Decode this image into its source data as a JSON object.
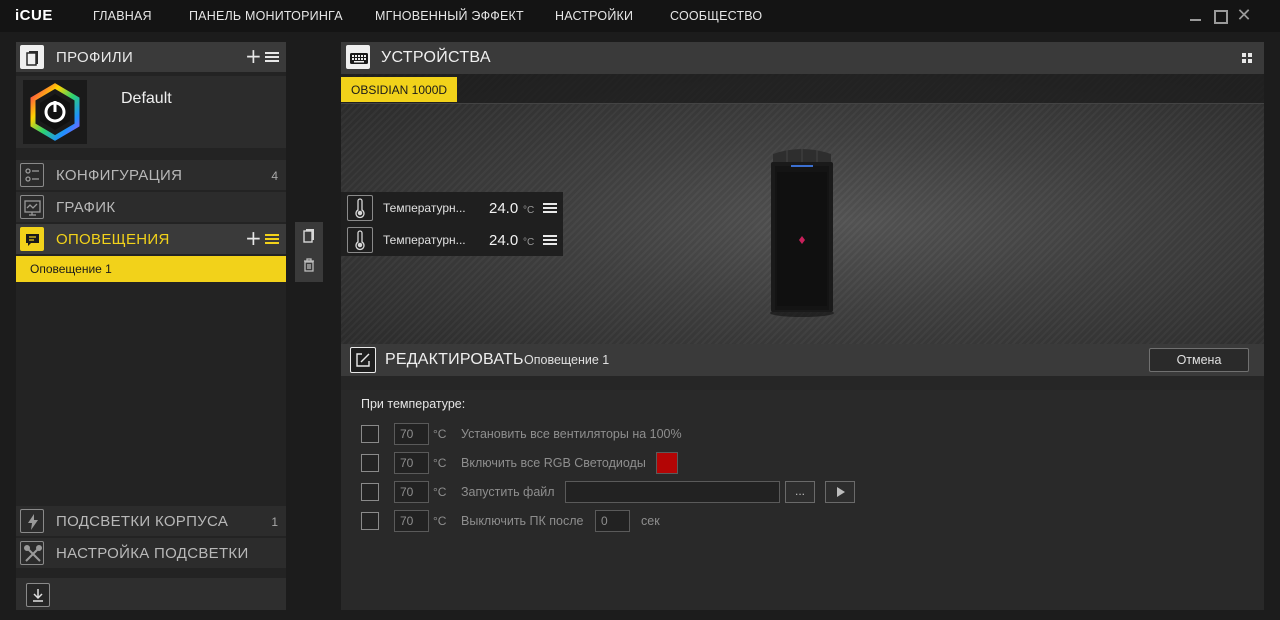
{
  "app": {
    "logo": "iCUE"
  },
  "nav": [
    "ГЛАВНАЯ",
    "ПАНЕЛЬ МОНИТОРИНГА",
    "МГНОВЕННЫЙ ЭФФЕКТ",
    "НАСТРОЙКИ",
    "СООБЩЕСТВО"
  ],
  "window_controls": {
    "close_glyph": "✕"
  },
  "profiles": {
    "title": "ПРОФИЛИ",
    "plus": "+",
    "items": [
      {
        "name": "Default"
      }
    ]
  },
  "sections": {
    "config": {
      "title": "КОНФИГУРАЦИЯ",
      "count": "4"
    },
    "graph": {
      "title": "ГРАФИК"
    },
    "notifications": {
      "title": "ОПОВЕЩЕНИЯ",
      "plus": "+",
      "items": [
        {
          "label": "Оповещение 1"
        }
      ]
    },
    "case_lighting": {
      "title": "ПОДСВЕТКИ КОРПУСА",
      "count": "1"
    },
    "lighting_setup": {
      "title": "НАСТРОЙКА ПОДСВЕТКИ"
    }
  },
  "devices": {
    "title": "УСТРОЙСТВА",
    "tabs": [
      {
        "label": "OBSIDIAN 1000D",
        "active": true
      }
    ],
    "sensors": [
      {
        "label": "Температурн...",
        "value": "24.0",
        "unit": "°C"
      },
      {
        "label": "Температурн...",
        "value": "24.0",
        "unit": "°C"
      }
    ]
  },
  "edit": {
    "title": "РЕДАКТИРОВАТЬ",
    "subtitle": "Оповещение 1",
    "cancel": "Отмена",
    "at_temperature": "При температуре:",
    "rules": [
      {
        "checked": false,
        "temp": "70",
        "unit": "°C",
        "label": "Установить все вентиляторы на 100%"
      },
      {
        "checked": false,
        "temp": "70",
        "unit": "°C",
        "label": "Включить все RGB Светодиоды",
        "color": "#b30505"
      },
      {
        "checked": false,
        "temp": "70",
        "unit": "°C",
        "label": "Запустить файл",
        "file": "",
        "browse": "..."
      },
      {
        "checked": false,
        "temp": "70",
        "unit": "°C",
        "label": "Выключить ПК после",
        "seconds": "0",
        "seconds_unit": "сек"
      }
    ]
  },
  "colors": {
    "accent": "#f2d21a",
    "panel": "#3a3a3a",
    "background": "#1c1c1c"
  },
  "icons": {
    "profiles": "profiles-icon",
    "config": "settings-list-icon",
    "graph": "graph-icon",
    "notifications": "chat-bubble-icon",
    "case_lighting": "lightning-icon",
    "lighting_setup": "tools-icon",
    "devices": "keyboard-icon",
    "edit": "edit-icon",
    "sensor": "thermometer-icon",
    "copy": "copy-icon",
    "delete": "trash-icon",
    "import": "import-icon",
    "layout": "grid-icon"
  }
}
